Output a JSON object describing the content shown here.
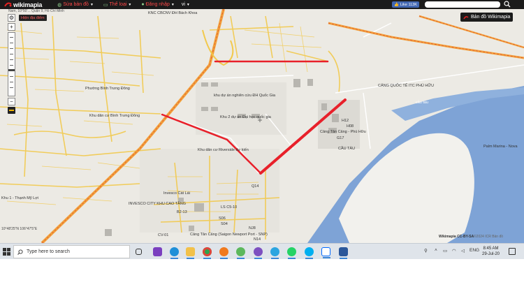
{
  "topbar": {
    "logo_text": "wikimapia",
    "menu": [
      {
        "label": "Sửa bản đồ",
        "icon": "globe-icon"
      },
      {
        "label": "Thể loại",
        "icon": "folder-icon"
      },
      {
        "label": "Đăng nhập",
        "icon": "user-icon"
      }
    ],
    "lang": "vi",
    "like_label": "Like 113K",
    "search_placeholder": ""
  },
  "map": {
    "coords_text": "Nam, 10°50'... Quận 9, Hồ Chí Minh",
    "badge_label": "Hiện địa điểm",
    "wikimapia_button": "Bản đồ Wikimapia",
    "attribution": "Wikimapia CC-BY-SA",
    "attribution2": "©2024 ICR Bản đồ",
    "scale_text": "10°48'25\"N 106°47'5\"E",
    "labels": [
      {
        "text": "KNC CBCNV ĐH Bách Khoa",
        "cls": "dark"
      },
      {
        "text": "Phường Bình Trưng Đông",
        "cls": "dark"
      },
      {
        "text": "Khu dân cư Bình Trưng Đông",
        "cls": "dark"
      },
      {
        "text": "khu dự án nghiên cứu ĐH Quốc Gia",
        "cls": "dark"
      },
      {
        "text": "Khu 2 dự án Đại học quốc gia",
        "cls": "dark"
      },
      {
        "text": "Khu dân cư Riverside dự kiến",
        "cls": "dark"
      },
      {
        "text": "CẢNG QUỐC TẾ ITC PHÚ HỮU",
        "cls": "dark"
      },
      {
        "text": "Cảng Tân Cảng - Phú Hữu",
        "cls": "dark"
      },
      {
        "text": "cầu tàu",
        "cls": "light"
      },
      {
        "text": "CẦU TÀU",
        "cls": "dark"
      },
      {
        "text": "Palm Marina - Nova",
        "cls": "dark"
      },
      {
        "text": "Invesco Cát Lái",
        "cls": "dark"
      },
      {
        "text": "INVESCO CITY KHU CAO TẦNG",
        "cls": "dark"
      },
      {
        "text": "Khu 1 - Thạnh Mỹ Lợi",
        "cls": "dark"
      },
      {
        "text": "Cảng Tân Cảng (Saigon Newport Port - SNP)",
        "cls": "dark"
      },
      {
        "text": "H12",
        "cls": "dark"
      },
      {
        "text": "H08",
        "cls": "dark"
      },
      {
        "text": "G17",
        "cls": "dark"
      },
      {
        "text": "Q14",
        "cls": "dark"
      },
      {
        "text": "B2-13",
        "cls": "dark"
      },
      {
        "text": "CV-01",
        "cls": "dark"
      },
      {
        "text": "LS C5-10",
        "cls": "dark"
      },
      {
        "text": "S06",
        "cls": "dark"
      },
      {
        "text": "S04",
        "cls": "dark"
      },
      {
        "text": "NJ8",
        "cls": "dark"
      },
      {
        "text": "N14",
        "cls": "dark"
      }
    ]
  },
  "taskbar": {
    "search_placeholder": "Type here to search",
    "apps": [
      "task-view-icon",
      "edge-icon",
      "file-explorer-icon",
      "chrome-icon",
      "firefox-icon",
      "app-icon",
      "viber-icon",
      "telegram-icon",
      "whatsapp-icon",
      "skype-icon",
      "zalo-icon",
      "word-icon"
    ],
    "lang": "ENG",
    "time": "8:45 AM",
    "date": "29-Jul-20"
  },
  "colors": {
    "topbar_bg": "#1b1b1b",
    "accent_red": "#ff4848",
    "route_red": "#e8202a",
    "water": "#7ea3d6",
    "map_bg": "#eceae4",
    "road_yellow": "#f2c94c"
  }
}
